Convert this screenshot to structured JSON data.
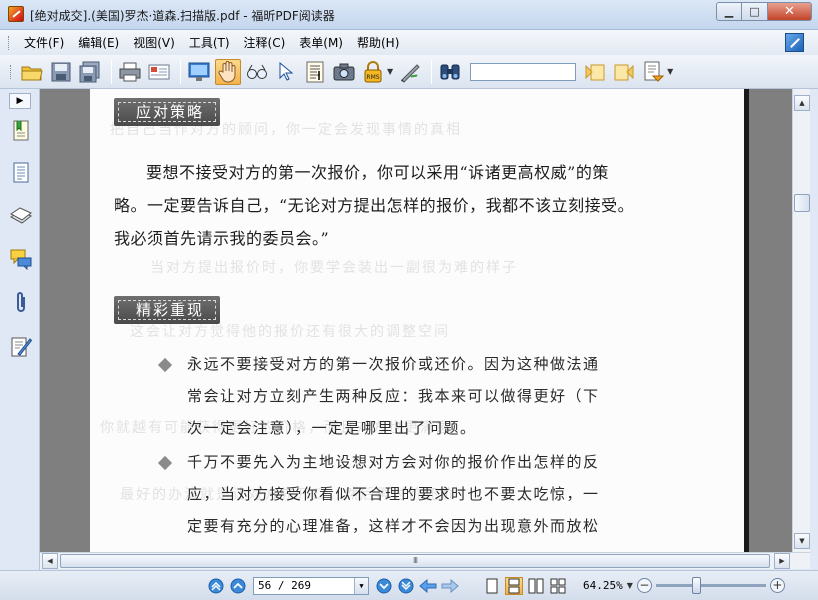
{
  "window": {
    "title": "[绝对成交].(美国)罗杰·道森.扫描版.pdf - 福昕PDF阅读器",
    "min_glyph": "▁",
    "max_glyph": "□",
    "close_glyph": "✕"
  },
  "menu": {
    "items": [
      "文件(F)",
      "编辑(E)",
      "视图(V)",
      "工具(T)",
      "注释(C)",
      "表单(M)",
      "帮助(H)"
    ]
  },
  "toolbar": {
    "search_value": "",
    "icons": [
      "open-icon",
      "save-icon",
      "save-as-icon",
      "print-icon",
      "email-icon",
      "fullscreen-icon",
      "hand-tool-icon",
      "zoom-tool-icon",
      "select-tool-icon",
      "text-select-icon",
      "snapshot-icon",
      "rms-lock-icon",
      "sign-icon",
      "find-icon",
      "find-prev-icon",
      "find-next-icon",
      "search-options-icon"
    ],
    "rms_label": "RMS"
  },
  "nav": {
    "toggle_glyph": "▶",
    "icons": [
      "bookmarks-icon",
      "pages-icon",
      "layers-icon",
      "comments-icon",
      "attachments-icon",
      "signatures-icon"
    ]
  },
  "document": {
    "section1_title": "应对策略",
    "para_lines": [
      "要想不接受对方的第一次报价，你可以采用“诉诸更高权威”的策",
      "略。一定要告诉自己，“无论对方提出怎样的报价，我都不该立刻接受。",
      "我必须首先请示我的委员会。”"
    ],
    "section2_title": "精彩重现",
    "bullet1": [
      "永远不要接受对方的第一次报价或还价。因为这种做法通",
      "常会让对方立刻产生两种反应：我本来可以做得更好（下",
      "次一定会注意），一定是哪里出了问题。"
    ],
    "bullet2": [
      "千万不要先入为主地设想对方会对你的报价作出怎样的反",
      "应，当对方接受你看似不合理的要求时也不要太吃惊，一",
      "定要有充分的心理准备，这样才不会因为出现意外而放松"
    ],
    "ghost_lines": [
      "把自己当作对方的顾问，你一定会发现事情的真相",
      "当对方提出报价时，你要学会装出一副很为难的样子",
      "这会让对方觉得他的报价还有很大的调整空间",
      "你就越有可能获得更好的价格，而且对方也更满意",
      "最好的办法就是让对方先开口，然后再讨价还价"
    ]
  },
  "scroll": {
    "up": "▲",
    "down": "▼",
    "left": "◀",
    "right": "▶",
    "grip": "III"
  },
  "status": {
    "page_value": "56 / 269",
    "zoom_value": "64.25%",
    "zoom_minus": "−",
    "zoom_plus": "+"
  }
}
